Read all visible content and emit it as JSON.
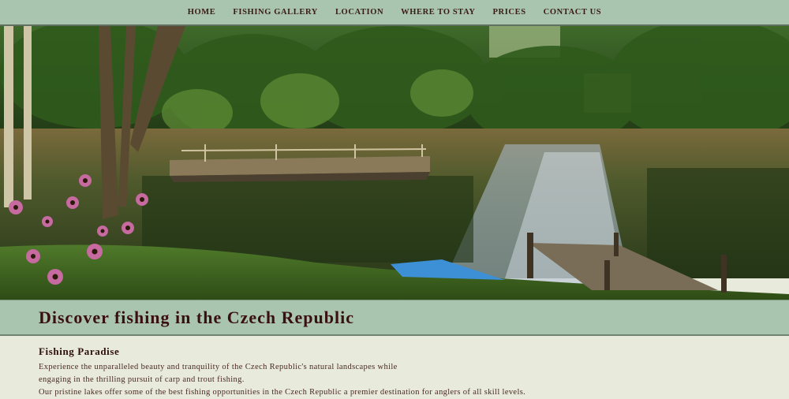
{
  "nav": {
    "items": [
      {
        "label": "HOME"
      },
      {
        "label": "FISHING GALLERY"
      },
      {
        "label": "LOCATION"
      },
      {
        "label": "WHERE TO STAY"
      },
      {
        "label": "PRICES"
      },
      {
        "label": "CONTACT US"
      }
    ]
  },
  "hero": {
    "image": "lake-with-pontoon-and-wooden-pier"
  },
  "title_bar": {
    "heading": "Discover fishing in the Czech Republic"
  },
  "content": {
    "subheading": "Fishing Paradise",
    "lines": [
      "Experience the unparalleled beauty and tranquility of the Czech Republic's natural landscapes while",
      "engaging in the thrilling pursuit of carp and trout fishing.",
      "Our pristine lakes offer some of the best fishing opportunities in the Czech Republic a premier destination for anglers of all skill levels."
    ]
  },
  "colors": {
    "nav_bg": "#a9c4af",
    "page_bg": "#e8eadb",
    "heading_text": "#3a0f10"
  }
}
